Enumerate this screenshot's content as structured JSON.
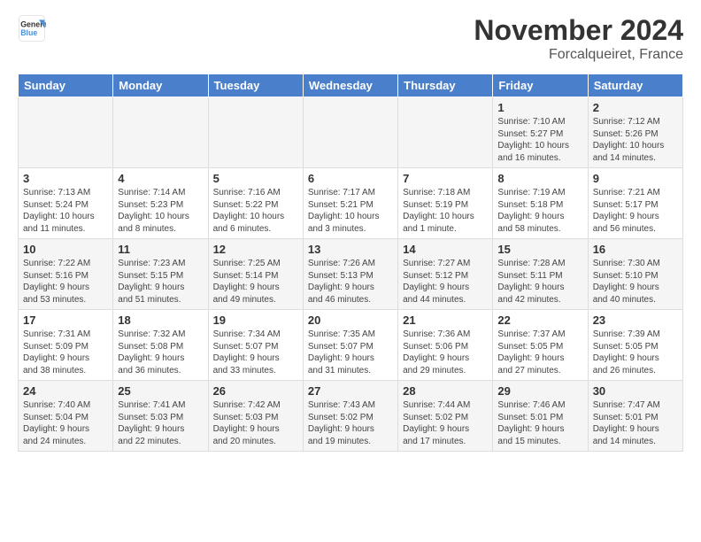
{
  "header": {
    "logo_general": "General",
    "logo_blue": "Blue",
    "month_title": "November 2024",
    "location": "Forcalqueiret, France"
  },
  "weekdays": [
    "Sunday",
    "Monday",
    "Tuesday",
    "Wednesday",
    "Thursday",
    "Friday",
    "Saturday"
  ],
  "weeks": [
    [
      {
        "day": "",
        "info": ""
      },
      {
        "day": "",
        "info": ""
      },
      {
        "day": "",
        "info": ""
      },
      {
        "day": "",
        "info": ""
      },
      {
        "day": "",
        "info": ""
      },
      {
        "day": "1",
        "info": "Sunrise: 7:10 AM\nSunset: 5:27 PM\nDaylight: 10 hours\nand 16 minutes."
      },
      {
        "day": "2",
        "info": "Sunrise: 7:12 AM\nSunset: 5:26 PM\nDaylight: 10 hours\nand 14 minutes."
      }
    ],
    [
      {
        "day": "3",
        "info": "Sunrise: 7:13 AM\nSunset: 5:24 PM\nDaylight: 10 hours\nand 11 minutes."
      },
      {
        "day": "4",
        "info": "Sunrise: 7:14 AM\nSunset: 5:23 PM\nDaylight: 10 hours\nand 8 minutes."
      },
      {
        "day": "5",
        "info": "Sunrise: 7:16 AM\nSunset: 5:22 PM\nDaylight: 10 hours\nand 6 minutes."
      },
      {
        "day": "6",
        "info": "Sunrise: 7:17 AM\nSunset: 5:21 PM\nDaylight: 10 hours\nand 3 minutes."
      },
      {
        "day": "7",
        "info": "Sunrise: 7:18 AM\nSunset: 5:19 PM\nDaylight: 10 hours\nand 1 minute."
      },
      {
        "day": "8",
        "info": "Sunrise: 7:19 AM\nSunset: 5:18 PM\nDaylight: 9 hours\nand 58 minutes."
      },
      {
        "day": "9",
        "info": "Sunrise: 7:21 AM\nSunset: 5:17 PM\nDaylight: 9 hours\nand 56 minutes."
      }
    ],
    [
      {
        "day": "10",
        "info": "Sunrise: 7:22 AM\nSunset: 5:16 PM\nDaylight: 9 hours\nand 53 minutes."
      },
      {
        "day": "11",
        "info": "Sunrise: 7:23 AM\nSunset: 5:15 PM\nDaylight: 9 hours\nand 51 minutes."
      },
      {
        "day": "12",
        "info": "Sunrise: 7:25 AM\nSunset: 5:14 PM\nDaylight: 9 hours\nand 49 minutes."
      },
      {
        "day": "13",
        "info": "Sunrise: 7:26 AM\nSunset: 5:13 PM\nDaylight: 9 hours\nand 46 minutes."
      },
      {
        "day": "14",
        "info": "Sunrise: 7:27 AM\nSunset: 5:12 PM\nDaylight: 9 hours\nand 44 minutes."
      },
      {
        "day": "15",
        "info": "Sunrise: 7:28 AM\nSunset: 5:11 PM\nDaylight: 9 hours\nand 42 minutes."
      },
      {
        "day": "16",
        "info": "Sunrise: 7:30 AM\nSunset: 5:10 PM\nDaylight: 9 hours\nand 40 minutes."
      }
    ],
    [
      {
        "day": "17",
        "info": "Sunrise: 7:31 AM\nSunset: 5:09 PM\nDaylight: 9 hours\nand 38 minutes."
      },
      {
        "day": "18",
        "info": "Sunrise: 7:32 AM\nSunset: 5:08 PM\nDaylight: 9 hours\nand 36 minutes."
      },
      {
        "day": "19",
        "info": "Sunrise: 7:34 AM\nSunset: 5:07 PM\nDaylight: 9 hours\nand 33 minutes."
      },
      {
        "day": "20",
        "info": "Sunrise: 7:35 AM\nSunset: 5:07 PM\nDaylight: 9 hours\nand 31 minutes."
      },
      {
        "day": "21",
        "info": "Sunrise: 7:36 AM\nSunset: 5:06 PM\nDaylight: 9 hours\nand 29 minutes."
      },
      {
        "day": "22",
        "info": "Sunrise: 7:37 AM\nSunset: 5:05 PM\nDaylight: 9 hours\nand 27 minutes."
      },
      {
        "day": "23",
        "info": "Sunrise: 7:39 AM\nSunset: 5:05 PM\nDaylight: 9 hours\nand 26 minutes."
      }
    ],
    [
      {
        "day": "24",
        "info": "Sunrise: 7:40 AM\nSunset: 5:04 PM\nDaylight: 9 hours\nand 24 minutes."
      },
      {
        "day": "25",
        "info": "Sunrise: 7:41 AM\nSunset: 5:03 PM\nDaylight: 9 hours\nand 22 minutes."
      },
      {
        "day": "26",
        "info": "Sunrise: 7:42 AM\nSunset: 5:03 PM\nDaylight: 9 hours\nand 20 minutes."
      },
      {
        "day": "27",
        "info": "Sunrise: 7:43 AM\nSunset: 5:02 PM\nDaylight: 9 hours\nand 19 minutes."
      },
      {
        "day": "28",
        "info": "Sunrise: 7:44 AM\nSunset: 5:02 PM\nDaylight: 9 hours\nand 17 minutes."
      },
      {
        "day": "29",
        "info": "Sunrise: 7:46 AM\nSunset: 5:01 PM\nDaylight: 9 hours\nand 15 minutes."
      },
      {
        "day": "30",
        "info": "Sunrise: 7:47 AM\nSunset: 5:01 PM\nDaylight: 9 hours\nand 14 minutes."
      }
    ]
  ]
}
